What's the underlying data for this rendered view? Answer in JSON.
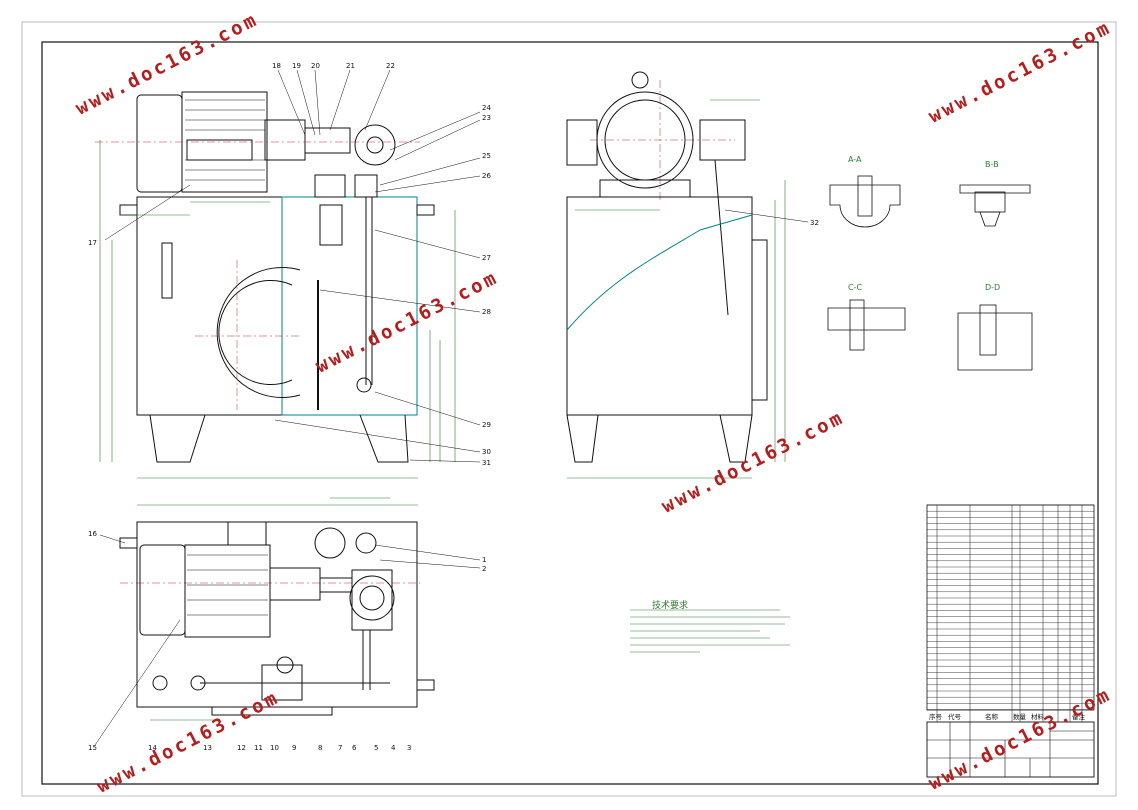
{
  "watermark": "www.doc163.com",
  "callouts": [
    "1",
    "2",
    "3",
    "4",
    "5",
    "6",
    "7",
    "8",
    "9",
    "10",
    "11",
    "12",
    "13",
    "14",
    "15",
    "16",
    "17",
    "18",
    "19",
    "20",
    "21",
    "22",
    "23",
    "24",
    "25",
    "26",
    "27",
    "28",
    "29",
    "30",
    "31",
    "32"
  ],
  "section_views": [
    "A-A",
    "B-B",
    "C-C",
    "D-D"
  ],
  "table_header": [
    "序号",
    "代号",
    "名称",
    "数量",
    "材料",
    "备注"
  ],
  "tech_req_title": "技术要求",
  "colors": {
    "line": "#111111",
    "green": "#2e7d32",
    "red": "#c62828",
    "watermark": "#b71c1c",
    "cyan": "#00838f"
  }
}
